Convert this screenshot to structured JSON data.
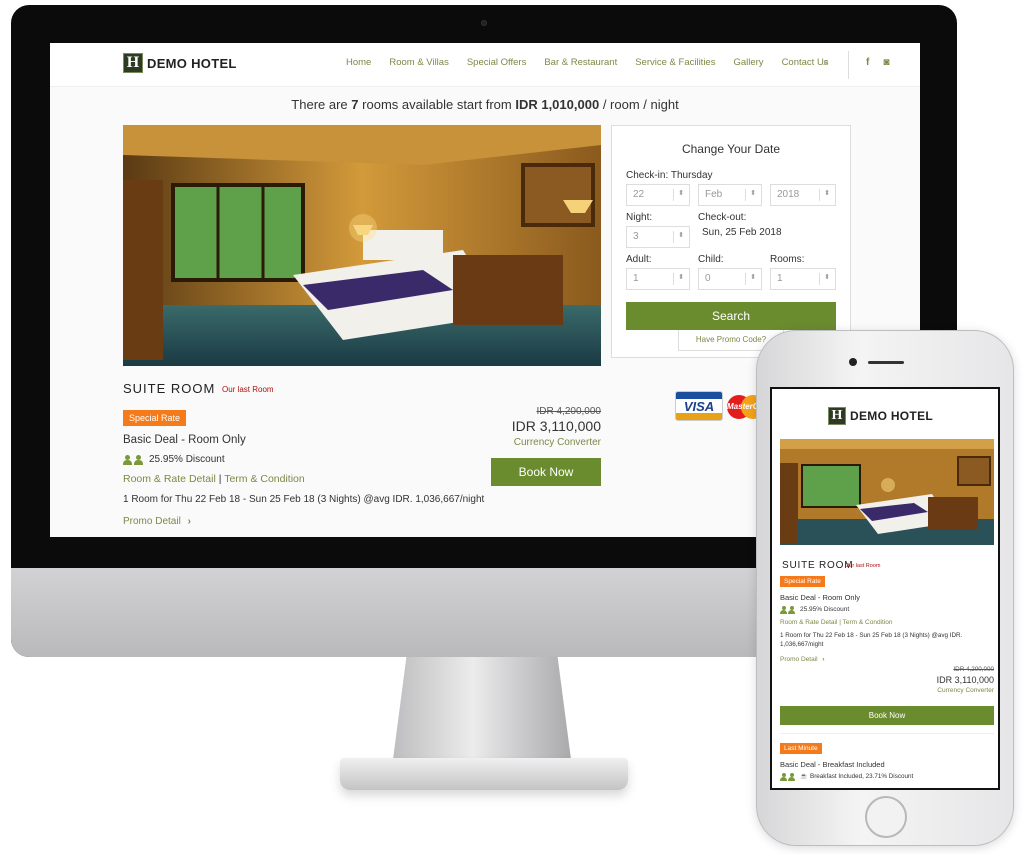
{
  "brand": {
    "logo_letter": "H",
    "name": "DEMO HOTEL"
  },
  "nav": {
    "items": [
      "Home",
      "Room & Villas",
      "Special Offers",
      "Bar & Restaurant",
      "Service & Facilities",
      "Gallery",
      "Contact Us"
    ],
    "search_icon": "⌕",
    "facebook_icon": "f",
    "instagram_icon": "◙"
  },
  "availability": {
    "prefix": "There are",
    "count": "7",
    "middle": "rooms available start from",
    "price": "IDR 1,010,000",
    "suffix": "/ room / night"
  },
  "date_panel": {
    "title": "Change Your Date",
    "checkin_label": "Check-in: Thursday",
    "checkin_day": "22",
    "checkin_month": "Feb",
    "checkin_year": "2018",
    "night_label": "Night:",
    "night_value": "3",
    "checkout_label": "Check-out:",
    "checkout_value": "Sun, 25 Feb 2018",
    "adult_label": "Adult:",
    "adult_value": "1",
    "child_label": "Child:",
    "child_value": "0",
    "rooms_label": "Rooms:",
    "rooms_value": "1",
    "search_label": "Search",
    "promo_label": "Have Promo Code?"
  },
  "room": {
    "title": "SUITE ROOM",
    "last_room": "Our last Room",
    "badge": "Special Rate",
    "deal": "Basic Deal - Room Only",
    "discount": "25.95% Discount",
    "rate_detail": "Room & Rate Detail",
    "separator": "|",
    "terms": "Term & Condition",
    "stay": "1 Room for Thu 22 Feb 18 - Sun 25 Feb 18 (3 Nights) @avg IDR. 1,036,667/night",
    "promo_detail": "Promo Detail",
    "old_price": "IDR 4,200,000",
    "new_price": "IDR 3,110,000",
    "currency": "Currency Converter",
    "book": "Book Now"
  },
  "cards": {
    "visa": "VISA",
    "mastercard": "MasterCard"
  },
  "mobile": {
    "room_title": "SUITE ROOM",
    "last_room": "Our last Room",
    "badge": "Special Rate",
    "deal": "Basic Deal - Room Only",
    "discount": "25.95% Discount",
    "links": "Room & Rate Detail | Term & Condition",
    "stay_line1": "1 Room for Thu 22 Feb 18 - Sun 25 Feb 18 (3 Nights) @avg IDR.",
    "stay_line2": "1,036,667/night",
    "promo_detail": "Promo Detail",
    "old_price": "IDR 4,200,000",
    "new_price": "IDR 3,110,000",
    "currency": "Currency Converter",
    "book": "Book Now",
    "badge2": "Last Minute",
    "deal2": "Basic Deal - Breakfast Included",
    "discount2": "Breakfast Included, 23.71% Discount"
  }
}
